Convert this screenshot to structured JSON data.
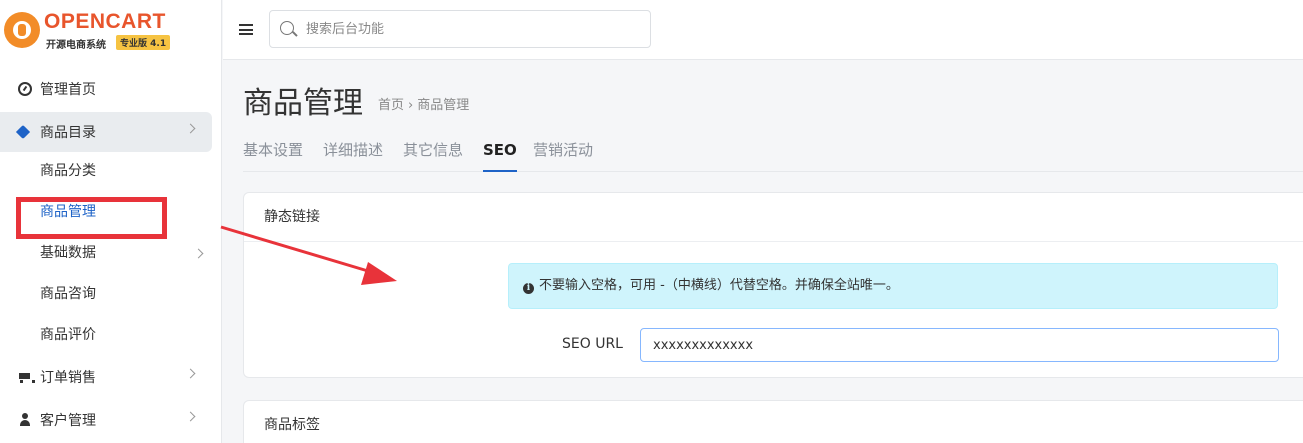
{
  "logo": {
    "brand": "OPENCART",
    "subtitle": "开源电商系统",
    "badge": "专业版 4.1"
  },
  "sidebar": {
    "items": [
      {
        "label": "管理首页",
        "icon": "dashboard-icon"
      },
      {
        "label": "商品目录",
        "icon": "tags-icon"
      },
      {
        "label": "订单销售",
        "icon": "cart-icon"
      },
      {
        "label": "客户管理",
        "icon": "user-icon"
      }
    ],
    "sub_items": [
      {
        "label": "商品分类"
      },
      {
        "label": "商品管理"
      },
      {
        "label": "基础数据"
      },
      {
        "label": "商品咨询"
      },
      {
        "label": "商品评价"
      }
    ]
  },
  "topbar": {
    "search_placeholder": "搜索后台功能"
  },
  "page": {
    "title": "商品管理",
    "breadcrumb": [
      "首页",
      "商品管理"
    ],
    "breadcrumb_sep": "›"
  },
  "tabs": [
    "基本设置",
    "详细描述",
    "其它信息",
    "SEO",
    "营销活动"
  ],
  "active_tab": "SEO",
  "seo_card": {
    "title": "静态链接",
    "alert": "不要输入空格，可用 -（中横线）代替空格。并确保全站唯一。",
    "alert_icon": "info-icon",
    "field_label": "SEO URL",
    "field_value": "xxxxxxxxxxxxx"
  },
  "tags_card": {
    "title": "商品标签"
  },
  "colors": {
    "accent": "#1e63c7",
    "highlight": "#e8333a",
    "alert_bg": "#cff4fc"
  }
}
